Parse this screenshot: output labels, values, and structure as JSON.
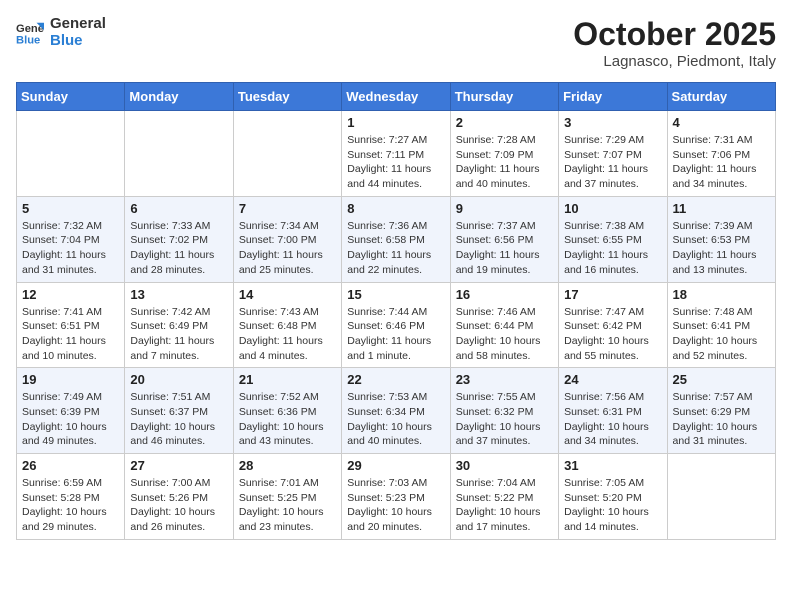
{
  "logo": {
    "line1": "General",
    "line2": "Blue"
  },
  "title": "October 2025",
  "location": "Lagnasco, Piedmont, Italy",
  "days_of_week": [
    "Sunday",
    "Monday",
    "Tuesday",
    "Wednesday",
    "Thursday",
    "Friday",
    "Saturday"
  ],
  "weeks": [
    [
      {
        "day": "",
        "info": ""
      },
      {
        "day": "",
        "info": ""
      },
      {
        "day": "",
        "info": ""
      },
      {
        "day": "1",
        "info": "Sunrise: 7:27 AM\nSunset: 7:11 PM\nDaylight: 11 hours and 44 minutes."
      },
      {
        "day": "2",
        "info": "Sunrise: 7:28 AM\nSunset: 7:09 PM\nDaylight: 11 hours and 40 minutes."
      },
      {
        "day": "3",
        "info": "Sunrise: 7:29 AM\nSunset: 7:07 PM\nDaylight: 11 hours and 37 minutes."
      },
      {
        "day": "4",
        "info": "Sunrise: 7:31 AM\nSunset: 7:06 PM\nDaylight: 11 hours and 34 minutes."
      }
    ],
    [
      {
        "day": "5",
        "info": "Sunrise: 7:32 AM\nSunset: 7:04 PM\nDaylight: 11 hours and 31 minutes."
      },
      {
        "day": "6",
        "info": "Sunrise: 7:33 AM\nSunset: 7:02 PM\nDaylight: 11 hours and 28 minutes."
      },
      {
        "day": "7",
        "info": "Sunrise: 7:34 AM\nSunset: 7:00 PM\nDaylight: 11 hours and 25 minutes."
      },
      {
        "day": "8",
        "info": "Sunrise: 7:36 AM\nSunset: 6:58 PM\nDaylight: 11 hours and 22 minutes."
      },
      {
        "day": "9",
        "info": "Sunrise: 7:37 AM\nSunset: 6:56 PM\nDaylight: 11 hours and 19 minutes."
      },
      {
        "day": "10",
        "info": "Sunrise: 7:38 AM\nSunset: 6:55 PM\nDaylight: 11 hours and 16 minutes."
      },
      {
        "day": "11",
        "info": "Sunrise: 7:39 AM\nSunset: 6:53 PM\nDaylight: 11 hours and 13 minutes."
      }
    ],
    [
      {
        "day": "12",
        "info": "Sunrise: 7:41 AM\nSunset: 6:51 PM\nDaylight: 11 hours and 10 minutes."
      },
      {
        "day": "13",
        "info": "Sunrise: 7:42 AM\nSunset: 6:49 PM\nDaylight: 11 hours and 7 minutes."
      },
      {
        "day": "14",
        "info": "Sunrise: 7:43 AM\nSunset: 6:48 PM\nDaylight: 11 hours and 4 minutes."
      },
      {
        "day": "15",
        "info": "Sunrise: 7:44 AM\nSunset: 6:46 PM\nDaylight: 11 hours and 1 minute."
      },
      {
        "day": "16",
        "info": "Sunrise: 7:46 AM\nSunset: 6:44 PM\nDaylight: 10 hours and 58 minutes."
      },
      {
        "day": "17",
        "info": "Sunrise: 7:47 AM\nSunset: 6:42 PM\nDaylight: 10 hours and 55 minutes."
      },
      {
        "day": "18",
        "info": "Sunrise: 7:48 AM\nSunset: 6:41 PM\nDaylight: 10 hours and 52 minutes."
      }
    ],
    [
      {
        "day": "19",
        "info": "Sunrise: 7:49 AM\nSunset: 6:39 PM\nDaylight: 10 hours and 49 minutes."
      },
      {
        "day": "20",
        "info": "Sunrise: 7:51 AM\nSunset: 6:37 PM\nDaylight: 10 hours and 46 minutes."
      },
      {
        "day": "21",
        "info": "Sunrise: 7:52 AM\nSunset: 6:36 PM\nDaylight: 10 hours and 43 minutes."
      },
      {
        "day": "22",
        "info": "Sunrise: 7:53 AM\nSunset: 6:34 PM\nDaylight: 10 hours and 40 minutes."
      },
      {
        "day": "23",
        "info": "Sunrise: 7:55 AM\nSunset: 6:32 PM\nDaylight: 10 hours and 37 minutes."
      },
      {
        "day": "24",
        "info": "Sunrise: 7:56 AM\nSunset: 6:31 PM\nDaylight: 10 hours and 34 minutes."
      },
      {
        "day": "25",
        "info": "Sunrise: 7:57 AM\nSunset: 6:29 PM\nDaylight: 10 hours and 31 minutes."
      }
    ],
    [
      {
        "day": "26",
        "info": "Sunrise: 6:59 AM\nSunset: 5:28 PM\nDaylight: 10 hours and 29 minutes."
      },
      {
        "day": "27",
        "info": "Sunrise: 7:00 AM\nSunset: 5:26 PM\nDaylight: 10 hours and 26 minutes."
      },
      {
        "day": "28",
        "info": "Sunrise: 7:01 AM\nSunset: 5:25 PM\nDaylight: 10 hours and 23 minutes."
      },
      {
        "day": "29",
        "info": "Sunrise: 7:03 AM\nSunset: 5:23 PM\nDaylight: 10 hours and 20 minutes."
      },
      {
        "day": "30",
        "info": "Sunrise: 7:04 AM\nSunset: 5:22 PM\nDaylight: 10 hours and 17 minutes."
      },
      {
        "day": "31",
        "info": "Sunrise: 7:05 AM\nSunset: 5:20 PM\nDaylight: 10 hours and 14 minutes."
      },
      {
        "day": "",
        "info": ""
      }
    ]
  ]
}
